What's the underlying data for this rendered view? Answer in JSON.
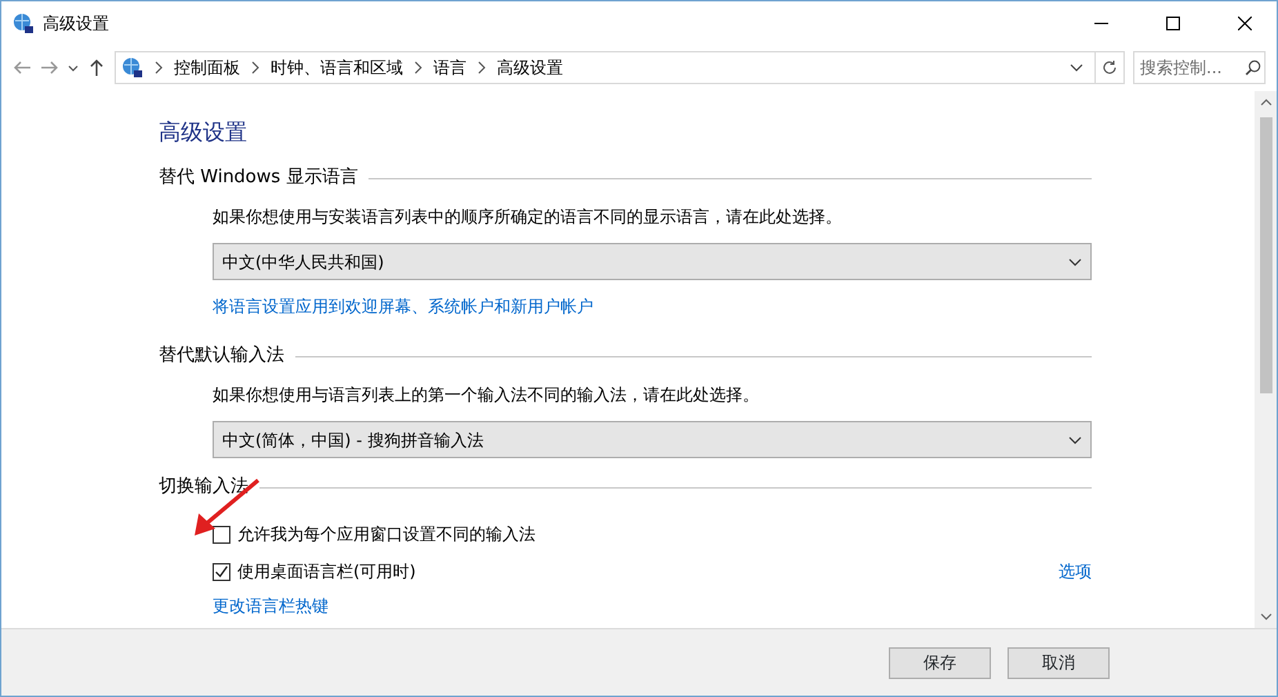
{
  "window": {
    "title": "高级设置"
  },
  "address_bar": {
    "crumbs": [
      "控制面板",
      "时钟、语言和区域",
      "语言",
      "高级设置"
    ]
  },
  "search": {
    "placeholder": "搜索控制..."
  },
  "heading": "高级设置",
  "sections": [
    {
      "title": "替代 Windows 显示语言",
      "items": [
        {
          "kind": "text",
          "text": "如果你想使用与安装语言列表中的顺序所确定的语言不同的显示语言，请在此处选择。"
        },
        {
          "kind": "select",
          "value": "中文(中华人民共和国)"
        },
        {
          "kind": "link",
          "text": "将语言设置应用到欢迎屏幕、系统帐户和新用户帐户"
        }
      ]
    },
    {
      "title": "替代默认输入法",
      "items": [
        {
          "kind": "text",
          "text": "如果你想使用与语言列表上的第一个输入法不同的输入法，请在此处选择。"
        },
        {
          "kind": "select",
          "value": "中文(简体，中国) - 搜狗拼音输入法"
        }
      ]
    },
    {
      "title": "切换输入法",
      "items": [
        {
          "kind": "checkbox",
          "label": "允许我为每个应用窗口设置不同的输入法",
          "checked": false
        },
        {
          "kind": "checkbox",
          "label": "使用桌面语言栏(可用时)",
          "checked": true,
          "link": "选项"
        },
        {
          "kind": "link",
          "text": "更改语言栏热键"
        }
      ]
    }
  ],
  "buttons": [
    "保存",
    "取消"
  ]
}
